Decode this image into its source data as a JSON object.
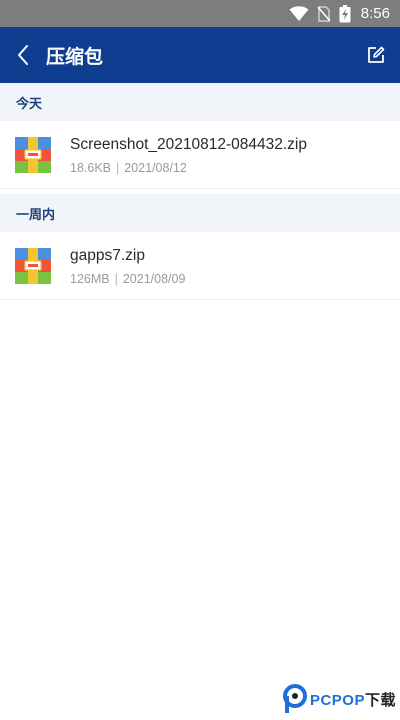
{
  "status_bar": {
    "time": "8:56",
    "icons": [
      "wifi-icon",
      "no-sim-icon",
      "battery-charging-icon"
    ]
  },
  "app_bar": {
    "title": "压缩包",
    "back_icon": "back-icon",
    "edit_icon": "edit-icon",
    "color": "#0f3d8f"
  },
  "sections": [
    {
      "header": "今天",
      "files": [
        {
          "name": "Screenshot_20210812-084432.zip",
          "size": "18.6KB",
          "date": "2021/08/12"
        }
      ]
    },
    {
      "header": "一周内",
      "files": [
        {
          "name": "gapps7.zip",
          "size": "126MB",
          "date": "2021/08/09"
        }
      ]
    }
  ],
  "meta_separator": "|",
  "watermark": {
    "brand": "PCPOP",
    "suffix": "下载"
  }
}
